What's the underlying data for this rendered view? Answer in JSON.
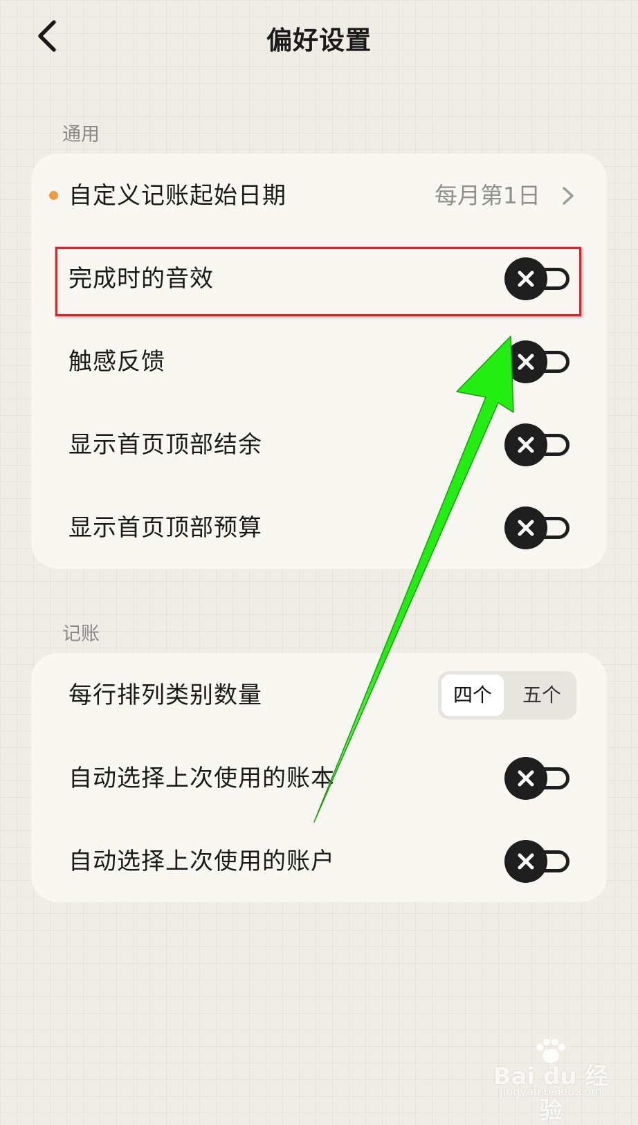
{
  "header": {
    "title": "偏好设置",
    "back_icon": "chevron-left-icon"
  },
  "sections": {
    "general": {
      "label": "通用",
      "start_date": {
        "label": "自定义记账起始日期",
        "value": "每月第1日",
        "dot_color": "#ef9a3c"
      },
      "toggles": [
        {
          "label": "完成时的音效",
          "state": "off"
        },
        {
          "label": "触感反馈",
          "state": "off"
        },
        {
          "label": "显示首页顶部结余",
          "state": "off"
        },
        {
          "label": "显示首页顶部预算",
          "state": "off"
        }
      ]
    },
    "bookkeeping": {
      "label": "记账",
      "category_count": {
        "label": "每行排列类别数量",
        "options": [
          "四个",
          "五个"
        ],
        "selected": "四个"
      },
      "toggles": [
        {
          "label": "自动选择上次使用的账本",
          "state": "off"
        },
        {
          "label": "自动选择上次使用的账户",
          "state": "off"
        }
      ]
    }
  },
  "annotation": {
    "highlight_color": "#d9262c",
    "arrow_color": "#22ee11"
  },
  "watermark": {
    "main": "Bai du 经验",
    "sub": "jingyan.baidu.com"
  }
}
